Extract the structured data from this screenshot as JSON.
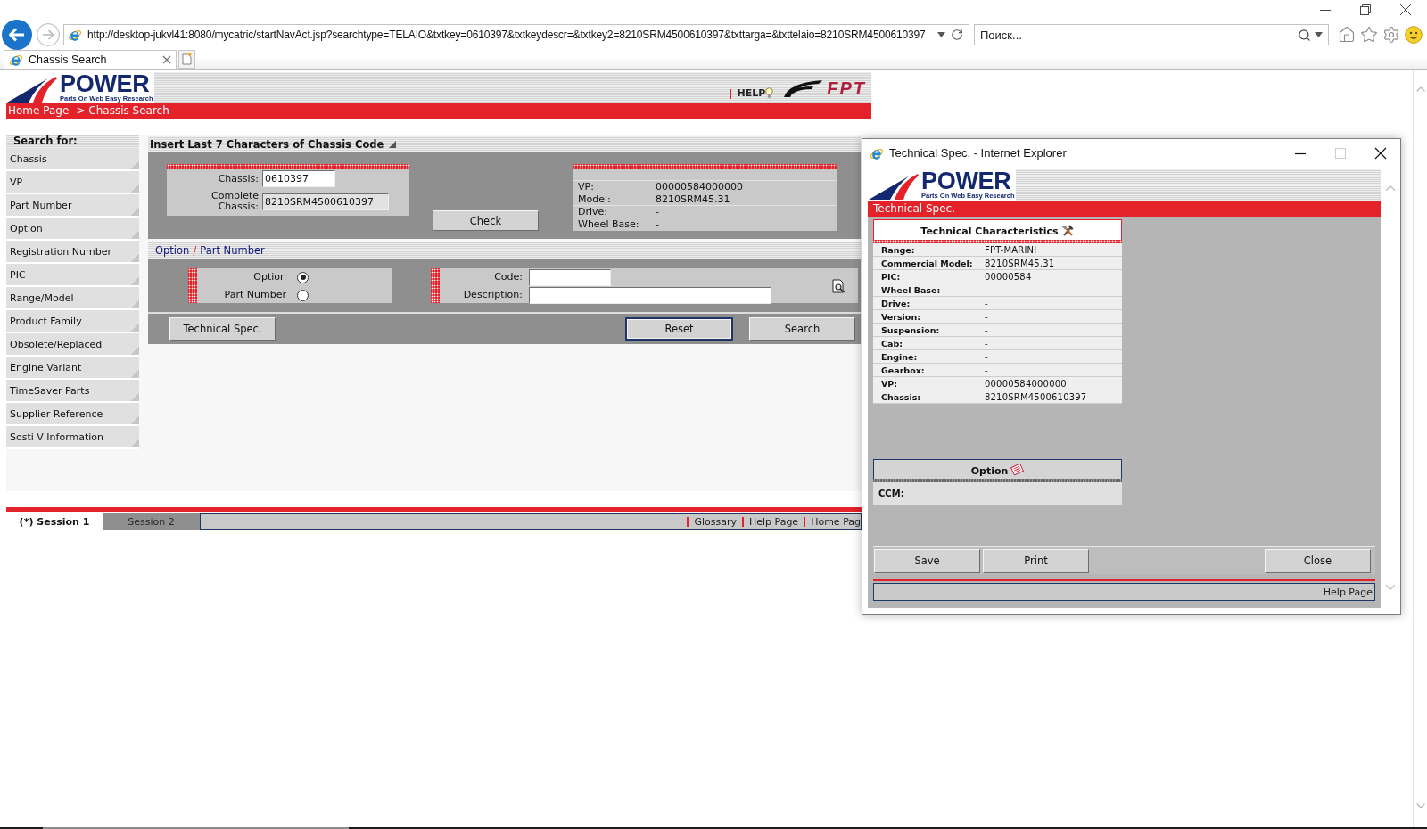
{
  "browser": {
    "address": "http://desktop-jukvl41:8080/mycatric/startNavAct.jsp?searchtype=TELAIO&txtkey=0610397&txtkeydescr=&txtkey2=8210SRM4500610397&txttarga=&txttelaio=8210SRM4500610397",
    "forward_disabled": true,
    "search": {
      "placeholder": "Поиск..."
    },
    "tabs": [
      {
        "label": "Chassis Search",
        "selected": true
      }
    ]
  },
  "page": {
    "header": {
      "logo": {
        "name": "POWER",
        "tagline": "Parts On Web Easy Research"
      },
      "help": "HELP",
      "brand": "FPT"
    },
    "breadcrumb": "Home Page -> Chassis Search",
    "sidebar": {
      "title": "Search for:",
      "items": [
        "Chassis",
        "VP",
        "Part Number",
        "Option",
        "Registration Number",
        "PIC",
        "Range/Model",
        "Product Family",
        "Obsolete/Replaced",
        "Engine Variant",
        "TimeSaver Parts",
        "Supplier Reference",
        "Sosti V Information"
      ]
    },
    "chassis_panel": {
      "title": "Insert Last 7 Characters of Chassis Code",
      "fields": [
        {
          "label": "Chassis:",
          "value": "0610397",
          "readonly": false
        },
        {
          "label": "Complete Chassis:",
          "value": "8210SRM4500610397",
          "readonly": true
        }
      ],
      "check_button": "Check",
      "info": [
        {
          "label": "VP:",
          "value": "00000584000000"
        },
        {
          "label": "Model:",
          "value": "8210SRM45.31"
        },
        {
          "label": "Drive:",
          "value": "-"
        },
        {
          "label": "Wheel Base:",
          "value": "-"
        }
      ]
    },
    "option_panel": {
      "title": [
        "Option",
        "Part Number"
      ],
      "separator": "/",
      "radios": [
        {
          "label": "Option",
          "selected": true
        },
        {
          "label": "Part Number",
          "selected": false
        }
      ],
      "fields": [
        {
          "label": "Code:"
        },
        {
          "label": "Description:"
        }
      ]
    },
    "buttons": [
      {
        "label": "Technical Spec.",
        "focused": false
      },
      {
        "label": "Reset",
        "focused": true
      },
      {
        "label": "Search",
        "focused": false
      }
    ],
    "sessions": [
      {
        "label": "(*) Session 1",
        "selected": true
      },
      {
        "label": "Session 2",
        "selected": false
      }
    ],
    "footer_links": [
      "Glossary",
      "Help Page",
      "Home Pag"
    ]
  },
  "popup": {
    "title": "Technical Spec. - Internet Explorer",
    "window_buttons": [
      {
        "kind": "minimize",
        "disabled": false
      },
      {
        "kind": "maximize",
        "disabled": true
      },
      {
        "kind": "close",
        "disabled": false
      }
    ],
    "logo": {
      "name": "POWER",
      "tagline": "Parts On Web Easy Research"
    },
    "banner": "Technical Spec.",
    "characteristics": {
      "title": "Technical Characteristics",
      "rows": [
        {
          "label": "Range:",
          "value": "FPT-MARINI"
        },
        {
          "label": "Commercial Model:",
          "value": "8210SRM45.31"
        },
        {
          "label": "PIC:",
          "value": "00000584"
        },
        {
          "label": "Wheel Base:",
          "value": "-"
        },
        {
          "label": "Drive:",
          "value": "-"
        },
        {
          "label": "Version:",
          "value": "-"
        },
        {
          "label": "Suspension:",
          "value": "-"
        },
        {
          "label": "Cab:",
          "value": "-"
        },
        {
          "label": "Engine:",
          "value": "-"
        },
        {
          "label": "Gearbox:",
          "value": "-"
        },
        {
          "label": "VP:",
          "value": "00000584000000"
        },
        {
          "label": "Chassis:",
          "value": "8210SRM4500610397"
        }
      ]
    },
    "option": {
      "title": "Option",
      "rows": [
        {
          "label": "CCM:"
        }
      ]
    },
    "buttons": [
      {
        "label": "Save"
      },
      {
        "label": "Print"
      },
      {
        "label": "Close"
      }
    ],
    "help_link": "Help Page"
  }
}
